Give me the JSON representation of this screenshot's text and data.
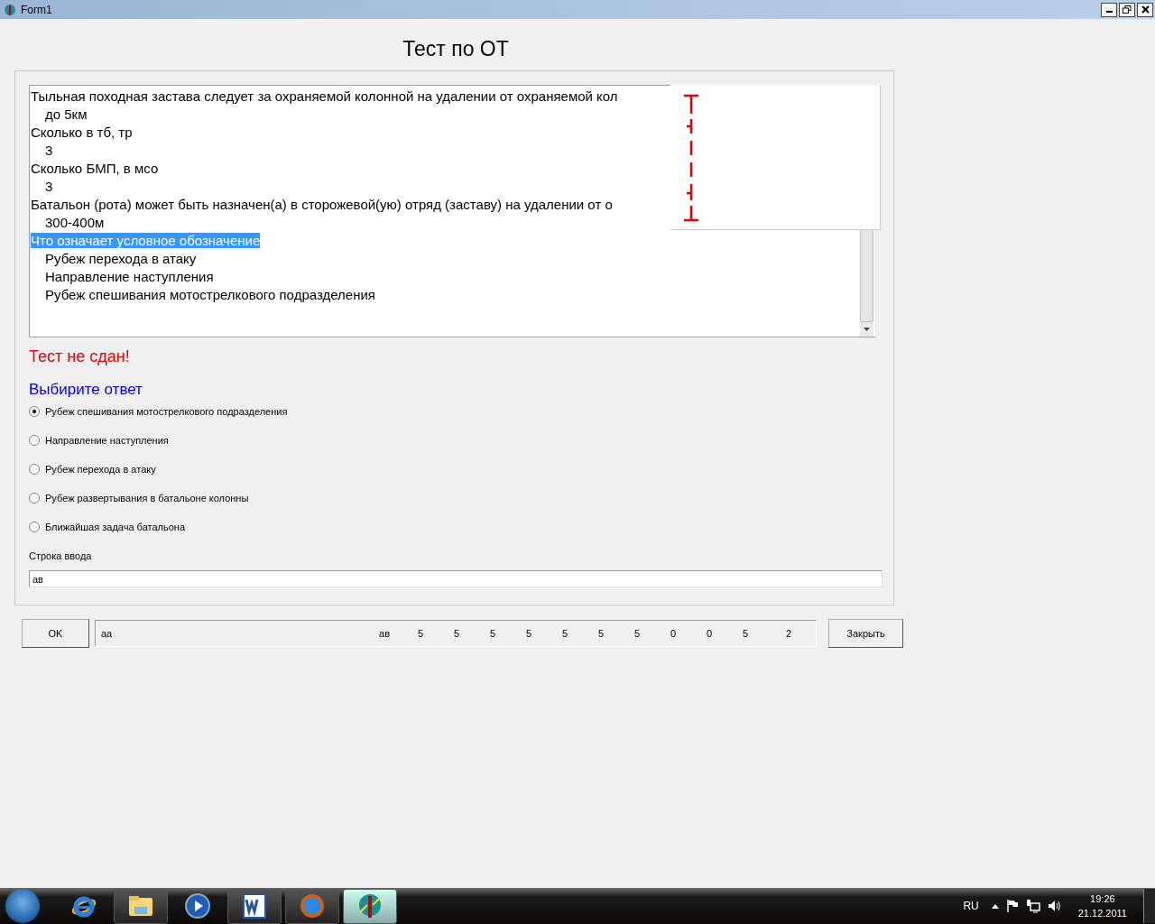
{
  "window": {
    "title": "Form1"
  },
  "heading": "Тест по ОТ",
  "memo": {
    "entries": [
      {
        "question": "Тыльная походная застава следует за охраняемой колонной на удалении от охраняемой кол",
        "selected": false,
        "answers": [
          "до 5км"
        ]
      },
      {
        "question": "Сколько в тб, тр",
        "selected": false,
        "answers": [
          "3"
        ]
      },
      {
        "question": "Сколько БМП, в мсо",
        "selected": false,
        "answers": [
          "3"
        ]
      },
      {
        "question": "Батальон (рота) может быть назначен(а) в сторожевой(ую) отряд (заставу) на удалении от о",
        "selected": false,
        "answers": [
          "300-400м"
        ]
      },
      {
        "question": "Что означает условное обозначение",
        "selected": true,
        "answers": [
          "Рубеж перехода в атаку",
          "Направление наступления",
          "Рубеж спешивания мотострелкового подразделения"
        ]
      }
    ]
  },
  "result": "Тест не сдан!",
  "prompt": "Выбирите ответ",
  "options": [
    {
      "label": "Рубеж спешивания мотострелкового подразделения",
      "selected": true
    },
    {
      "label": "Направление наступления",
      "selected": false
    },
    {
      "label": "Рубеж перехода в атаку",
      "selected": false
    },
    {
      "label": "Рубеж развертывания в батальоне колонны",
      "selected": false
    },
    {
      "label": "Ближайшая задача батальона",
      "selected": false
    }
  ],
  "input": {
    "label": "Строка ввода",
    "value": "ав"
  },
  "ok_button": "OK",
  "status_bar": {
    "cells": [
      "аа",
      "ав",
      "5",
      "5",
      "5",
      "5",
      "5",
      "5",
      "5",
      "0",
      "0",
      "5",
      "2"
    ]
  },
  "close_button": "Закрыть",
  "taskbar": {
    "language": "RU",
    "time": "19:26",
    "date": "21.12.2011"
  }
}
